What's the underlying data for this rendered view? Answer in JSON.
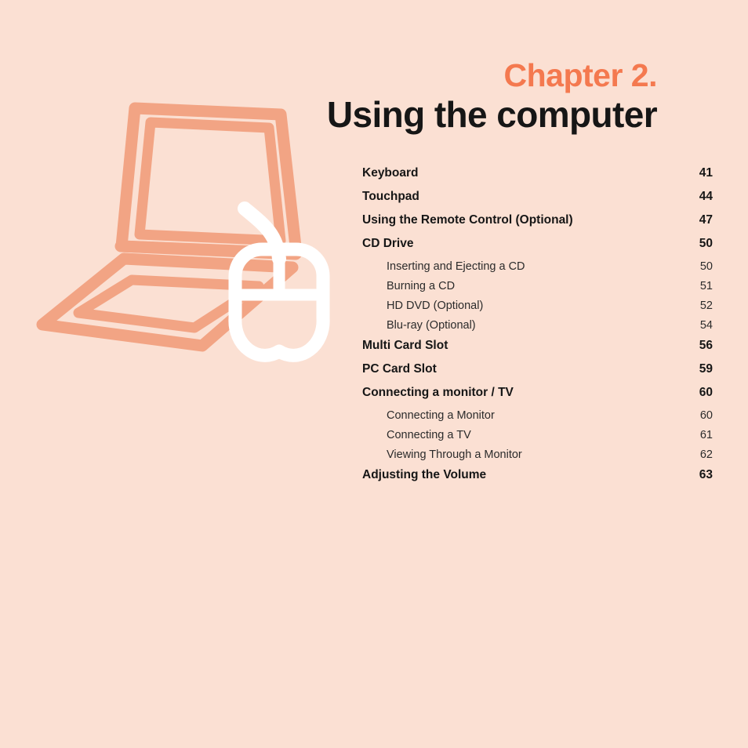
{
  "page": {
    "background_color": "#fbe0d3",
    "accent_color": "#f4794f",
    "illustration_color": "#f2a484",
    "mouse_color": "#ffffff",
    "text_color": "#161616"
  },
  "heading": {
    "chapter_label": "Chapter 2.",
    "chapter_title": "Using the computer"
  },
  "illustration": {
    "laptop_icon_name": "laptop-illustration",
    "mouse_icon_name": "mouse-illustration"
  },
  "toc": {
    "entries": [
      {
        "level": 1,
        "label": "Keyboard",
        "page": "41"
      },
      {
        "level": 1,
        "label": "Touchpad",
        "page": "44"
      },
      {
        "level": 1,
        "label": "Using the Remote Control (Optional)",
        "page": "47"
      },
      {
        "level": 1,
        "label": "CD Drive",
        "page": "50"
      },
      {
        "level": 2,
        "label": "Inserting and Ejecting a CD",
        "page": "50"
      },
      {
        "level": 2,
        "label": "Burning a CD",
        "page": "51"
      },
      {
        "level": 2,
        "label": "HD DVD (Optional)",
        "page": "52"
      },
      {
        "level": 2,
        "label": "Blu-ray (Optional)",
        "page": "54"
      },
      {
        "level": 1,
        "label": "Multi Card Slot",
        "page": "56"
      },
      {
        "level": 1,
        "label": "PC Card Slot",
        "page": "59"
      },
      {
        "level": 1,
        "label": "Connecting a monitor / TV",
        "page": "60"
      },
      {
        "level": 2,
        "label": "Connecting a Monitor",
        "page": "60"
      },
      {
        "level": 2,
        "label": "Connecting a TV",
        "page": "61"
      },
      {
        "level": 2,
        "label": "Viewing Through a Monitor",
        "page": "62"
      },
      {
        "level": 1,
        "label": "Adjusting the Volume",
        "page": "63"
      }
    ]
  }
}
